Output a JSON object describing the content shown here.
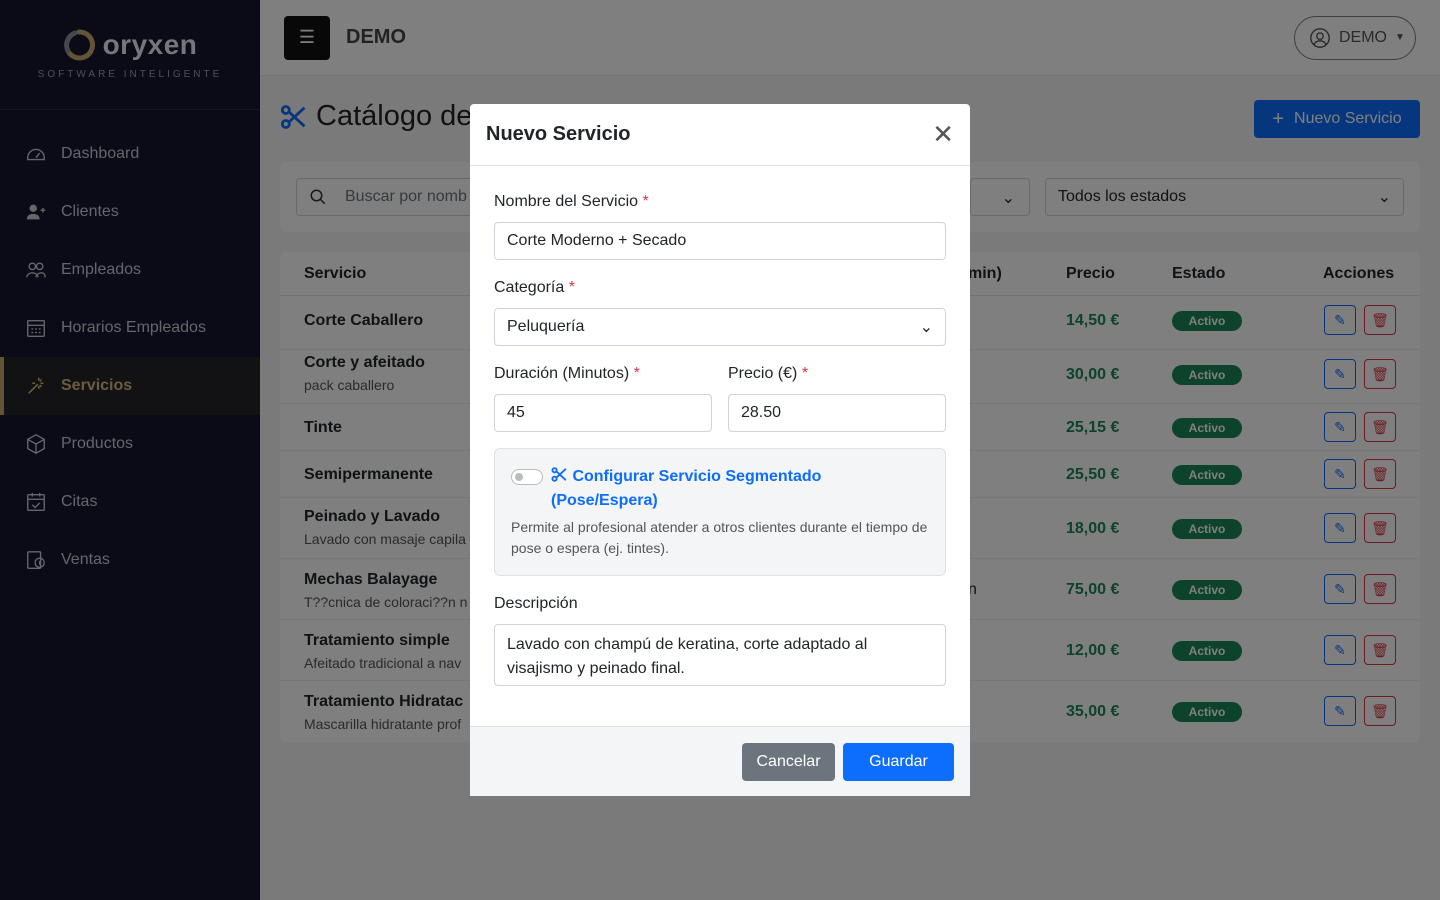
{
  "brand": {
    "name": "oryxen",
    "tagline": "SOFTWARE INTELIGENTE"
  },
  "sidebar": {
    "items": [
      {
        "label": "Dashboard",
        "icon": "dashboard-gauge-icon"
      },
      {
        "label": "Clientes",
        "icon": "clients-icon"
      },
      {
        "label": "Empleados",
        "icon": "employees-icon"
      },
      {
        "label": "Horarios Empleados",
        "icon": "calendar-grid-icon"
      },
      {
        "label": "Servicios",
        "icon": "magic-wand-icon",
        "active": true
      },
      {
        "label": "Productos",
        "icon": "box-icon"
      },
      {
        "label": "Citas",
        "icon": "calendar-check-icon"
      },
      {
        "label": "Ventas",
        "icon": "sales-icon"
      }
    ]
  },
  "topbar": {
    "company": "DEMO",
    "user": "DEMO"
  },
  "page": {
    "title": "Catálogo de",
    "new_button": "Nuevo Servicio",
    "search_placeholder": "Buscar por nomb",
    "status_filter": "Todos los estados"
  },
  "table": {
    "headers": {
      "service": "Servicio",
      "duration": "min)",
      "price": "Precio",
      "status": "Estado",
      "actions": "Acciones"
    },
    "rows": [
      {
        "name": "Corte Caballero",
        "desc": "",
        "price": "14,50 €",
        "status": "Activo"
      },
      {
        "name": "Corte y afeitado",
        "desc": "pack caballero",
        "price": "30,00 €",
        "status": "Activo"
      },
      {
        "name": "Tinte",
        "desc": "",
        "price": "25,15 €",
        "status": "Activo"
      },
      {
        "name": "Semipermanente",
        "desc": "",
        "price": "25,50 €",
        "status": "Activo"
      },
      {
        "name": "Peinado y Lavado",
        "desc": "Lavado con masaje capila",
        "price": "18,00 €",
        "status": "Activo"
      },
      {
        "name": "Mechas Balayage",
        "desc": "T??cnica de coloraci??n n",
        "price": "75,00 €",
        "status": "Activo",
        "duration_fragment": "n"
      },
      {
        "name": "Tratamiento simple",
        "desc": "Afeitado tradicional a nav",
        "price": "12,00 €",
        "status": "Activo"
      },
      {
        "name": "Tratamiento Hidratac",
        "desc": "Mascarilla hidratante prof",
        "price": "35,00 €",
        "status": "Activo"
      }
    ]
  },
  "modal": {
    "title": "Nuevo Servicio",
    "name_label": "Nombre del Servicio",
    "name_value": "Corte Moderno + Secado",
    "category_label": "Categoría",
    "category_value": "Peluquería",
    "duration_label": "Duración (Minutos)",
    "duration_value": "45",
    "price_label": "Precio (€)",
    "price_value": "28.50",
    "required_mark": "*",
    "segmented_title": "Configurar Servicio Segmentado (Pose/Espera)",
    "segmented_help": "Permite al profesional atender a otros clientes durante el tiempo de pose o espera (ej. tintes).",
    "description_label": "Descripción",
    "description_value": "Lavado con champú de keratina, corte adaptado al visajismo y peinado final.",
    "cancel": "Cancelar",
    "save": "Guardar"
  },
  "colors": {
    "primary": "#0d6efd",
    "danger": "#dc3545",
    "success": "#198754",
    "sidebar": "#14172c",
    "accent": "#c8a96e"
  }
}
